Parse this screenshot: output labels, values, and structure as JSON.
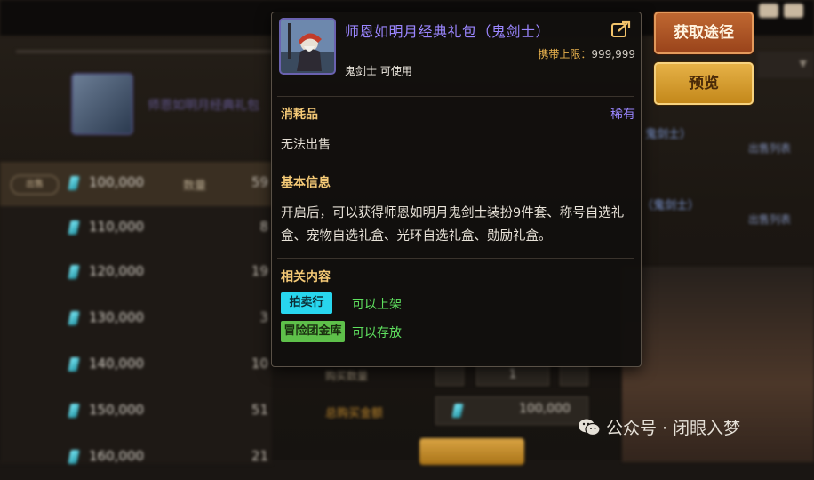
{
  "tooltip": {
    "title": "师恩如明月经典礼包（鬼剑士）",
    "carry_limit_label": "携带上限：",
    "carry_limit_value": "999,999",
    "usable_class": "鬼剑士 可使用",
    "category": "消耗品",
    "rarity": "稀有",
    "sell_status": "无法出售",
    "basic_info_heading": "基本信息",
    "description": "开启后，可以获得师恩如明月鬼剑士装扮9件套、称号自选礼盒、宠物自选礼盒、光环自选礼盒、勋励礼盒。",
    "related_heading": "相关内容",
    "tags": [
      {
        "label": "拍卖行",
        "desc": "可以上架"
      },
      {
        "label": "冒险团金库",
        "desc": "可以存放"
      }
    ],
    "colors": {
      "title": "#9b86ff",
      "heading": "#f4c976",
      "rarity": "#9a86ff",
      "tag_desc": "#5fe05f"
    }
  },
  "side_buttons": {
    "get_source": "获取途径",
    "preview": "预览"
  },
  "background": {
    "item_title": "师恩如明月经典礼包",
    "selected_tag": "出售",
    "qty_label": "数量",
    "rows": [
      {
        "price": "100,000",
        "qty": "59"
      },
      {
        "price": "110,000",
        "qty": "8"
      },
      {
        "price": "120,000",
        "qty": "19"
      },
      {
        "price": "130,000",
        "qty": "3"
      },
      {
        "price": "140,000",
        "qty": "10"
      },
      {
        "price": "150,000",
        "qty": "51"
      },
      {
        "price": "160,000",
        "qty": "21"
      }
    ],
    "right_text_1": "鬼剑士）",
    "right_text_2": "（鬼剑士）",
    "right_link": "出售列表",
    "buy_qty_label": "购买数量",
    "buy_qty_value": "1",
    "total_label": "总购买金额",
    "total_value": "100,000"
  },
  "watermark": "公众号 · 闭眼入梦"
}
